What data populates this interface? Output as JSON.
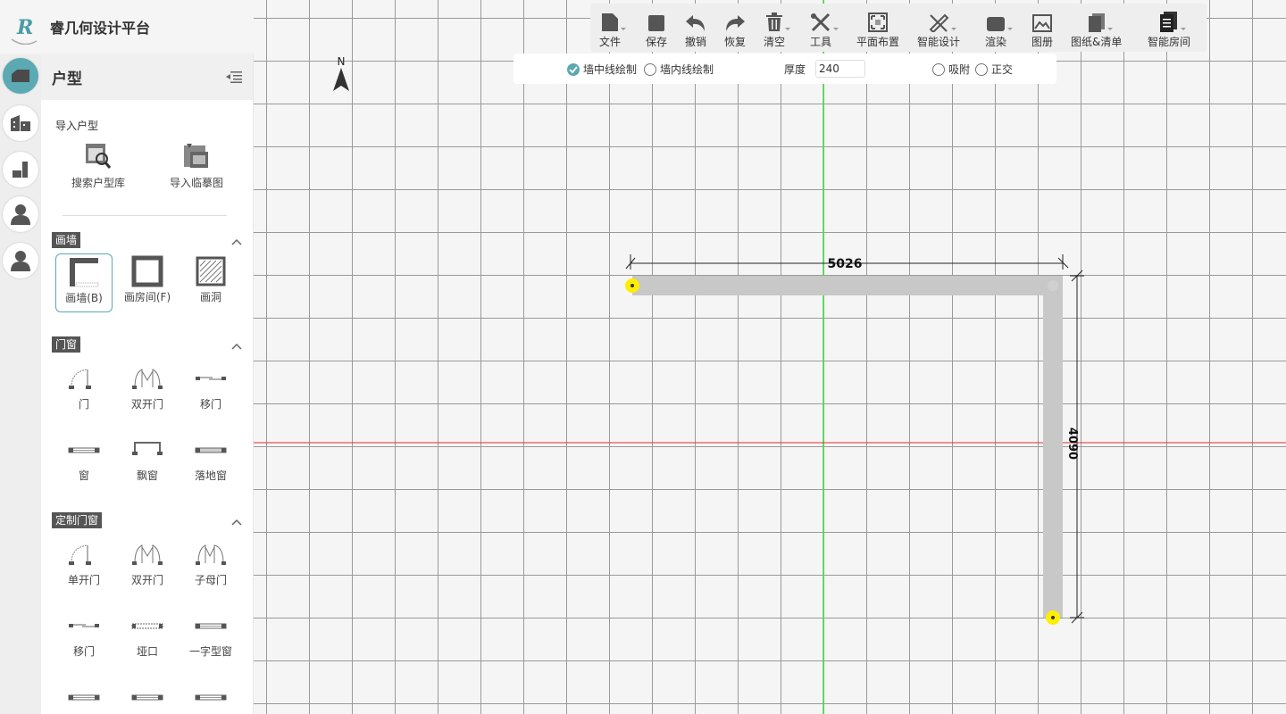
{
  "app": {
    "title": "睿几何设计平台"
  },
  "toolbar": {
    "items": [
      {
        "label": "文件",
        "icon": "file-icon",
        "dropdown": true
      },
      {
        "label": "保存",
        "icon": "save-icon",
        "dropdown": false
      },
      {
        "label": "撤销",
        "icon": "undo-icon",
        "dropdown": false
      },
      {
        "label": "恢复",
        "icon": "redo-icon",
        "dropdown": false
      },
      {
        "label": "清空",
        "icon": "trash-icon",
        "dropdown": true
      },
      {
        "label": "工具",
        "icon": "tools-icon",
        "dropdown": true
      },
      {
        "label": "平面布置",
        "icon": "layout-icon",
        "dropdown": false
      },
      {
        "label": "智能设计",
        "icon": "smart-design-icon",
        "dropdown": true
      },
      {
        "label": "渲染",
        "icon": "render-icon",
        "dropdown": true
      },
      {
        "label": "图册",
        "icon": "album-icon",
        "dropdown": false
      },
      {
        "label": "图纸&清单",
        "icon": "drawings-icon",
        "dropdown": true
      },
      {
        "label": "智能房间",
        "icon": "smart-room-icon",
        "dropdown": true
      }
    ]
  },
  "options": {
    "center_line": "墙中线绘制",
    "inner_line": "墙内线绘制",
    "thickness_label": "厚度",
    "thickness_value": "240",
    "snap": "吸附",
    "orthogonal": "正交",
    "center_line_checked": true
  },
  "panel": {
    "title": "户型",
    "import": {
      "label": "导入户型",
      "search": "搜索户型库",
      "sketch": "导入临摹图"
    },
    "draw_wall": {
      "tag": "画墙",
      "tools": [
        "画墙(B)",
        "画房间(F)",
        "画洞"
      ]
    },
    "doors_windows": {
      "tag": "门窗",
      "tools": [
        "门",
        "双开门",
        "移门",
        "窗",
        "飘窗",
        "落地窗"
      ]
    },
    "custom": {
      "tag": "定制门窗",
      "tools": [
        "单开门",
        "双开门",
        "子母门",
        "移门",
        "垭口",
        "一字型窗"
      ]
    }
  },
  "canvas": {
    "north": "N",
    "dim_horizontal": "5026",
    "dim_vertical": "4090",
    "colors": {
      "axis_x": "#e03030",
      "axis_y": "#44dd44",
      "wall": "#c8c8c8",
      "endpoint": "#ffee00"
    }
  }
}
